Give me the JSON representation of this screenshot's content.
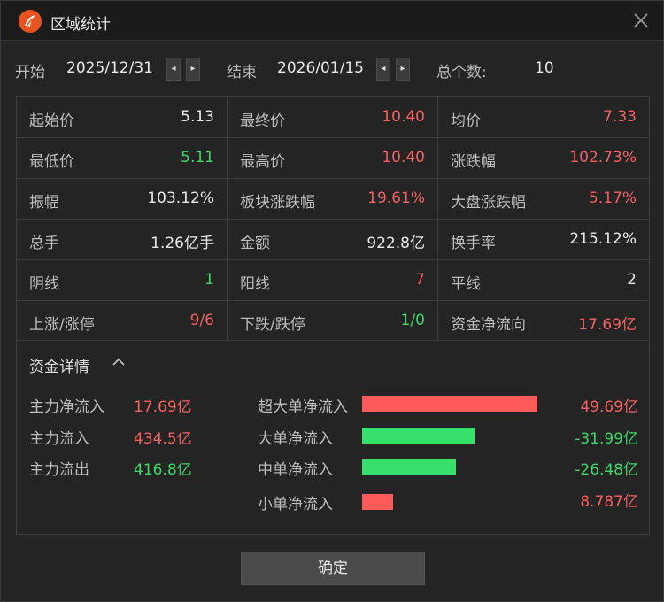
{
  "title": "区域统计",
  "range": {
    "start_label": "开始",
    "start_date": "2025/12/31",
    "end_label": "结束",
    "end_date": "2026/01/15",
    "count_label": "总个数:",
    "count_value": "10",
    "prev_glyph": "◂",
    "next_glyph": "▸"
  },
  "stats": [
    [
      {
        "label": "起始价",
        "value": "5.13",
        "tone": "white"
      },
      {
        "label": "最终价",
        "value": "10.40",
        "tone": "red"
      },
      {
        "label": "均价",
        "value": "7.33",
        "tone": "red"
      }
    ],
    [
      {
        "label": "最低价",
        "value": "5.11",
        "tone": "green"
      },
      {
        "label": "最高价",
        "value": "10.40",
        "tone": "red"
      },
      {
        "label": "涨跌幅",
        "value": "102.73%",
        "tone": "red"
      }
    ],
    [
      {
        "label": "振幅",
        "value": "103.12%",
        "tone": "white"
      },
      {
        "label": "板块涨跌幅",
        "value": "19.61%",
        "tone": "red"
      },
      {
        "label": "大盘涨跌幅",
        "value": "5.17%",
        "tone": "red"
      }
    ],
    [
      {
        "label": "总手",
        "value": "1.26亿手",
        "tone": "white"
      },
      {
        "label": "金额",
        "value": "922.8亿",
        "tone": "white"
      },
      {
        "label": "换手率",
        "value": "215.12%",
        "tone": "white"
      }
    ],
    [
      {
        "label": "阴线",
        "value": "1",
        "tone": "green"
      },
      {
        "label": "阳线",
        "value": "7",
        "tone": "red"
      },
      {
        "label": "平线",
        "value": "2",
        "tone": "white"
      }
    ],
    [
      {
        "label": "上涨/涨停",
        "value": "9/6",
        "tone": "red"
      },
      {
        "label": "下跌/跌停",
        "value": "1/0",
        "tone": "green"
      },
      {
        "label": "资金净流向",
        "value": "17.69亿",
        "tone": "red"
      }
    ]
  ],
  "funds": {
    "title": "资金详情",
    "left": [
      {
        "label": "主力净流入",
        "value": "17.69亿"
      },
      {
        "label": "主力流入",
        "value": "434.5亿"
      },
      {
        "label": "主力流出",
        "value": "416.8亿"
      }
    ],
    "orders": [
      {
        "label": "超大单净流入",
        "value": "49.69亿",
        "amount": 49.69
      },
      {
        "label": "大单净流入",
        "value": "-31.99亿",
        "amount": -31.99
      },
      {
        "label": "中单净流入",
        "value": "-26.48亿",
        "amount": -26.48
      },
      {
        "label": "小单净流入",
        "value": "8.787亿",
        "amount": 8.787
      }
    ]
  },
  "ok_label": "确定",
  "colors": {
    "up": "#f26060",
    "down": "#3fd66a",
    "brand": "#e8541f"
  },
  "icons": {
    "logo": "brand-logo-icon",
    "close": "close-icon",
    "collapse": "chevron-up-icon"
  }
}
